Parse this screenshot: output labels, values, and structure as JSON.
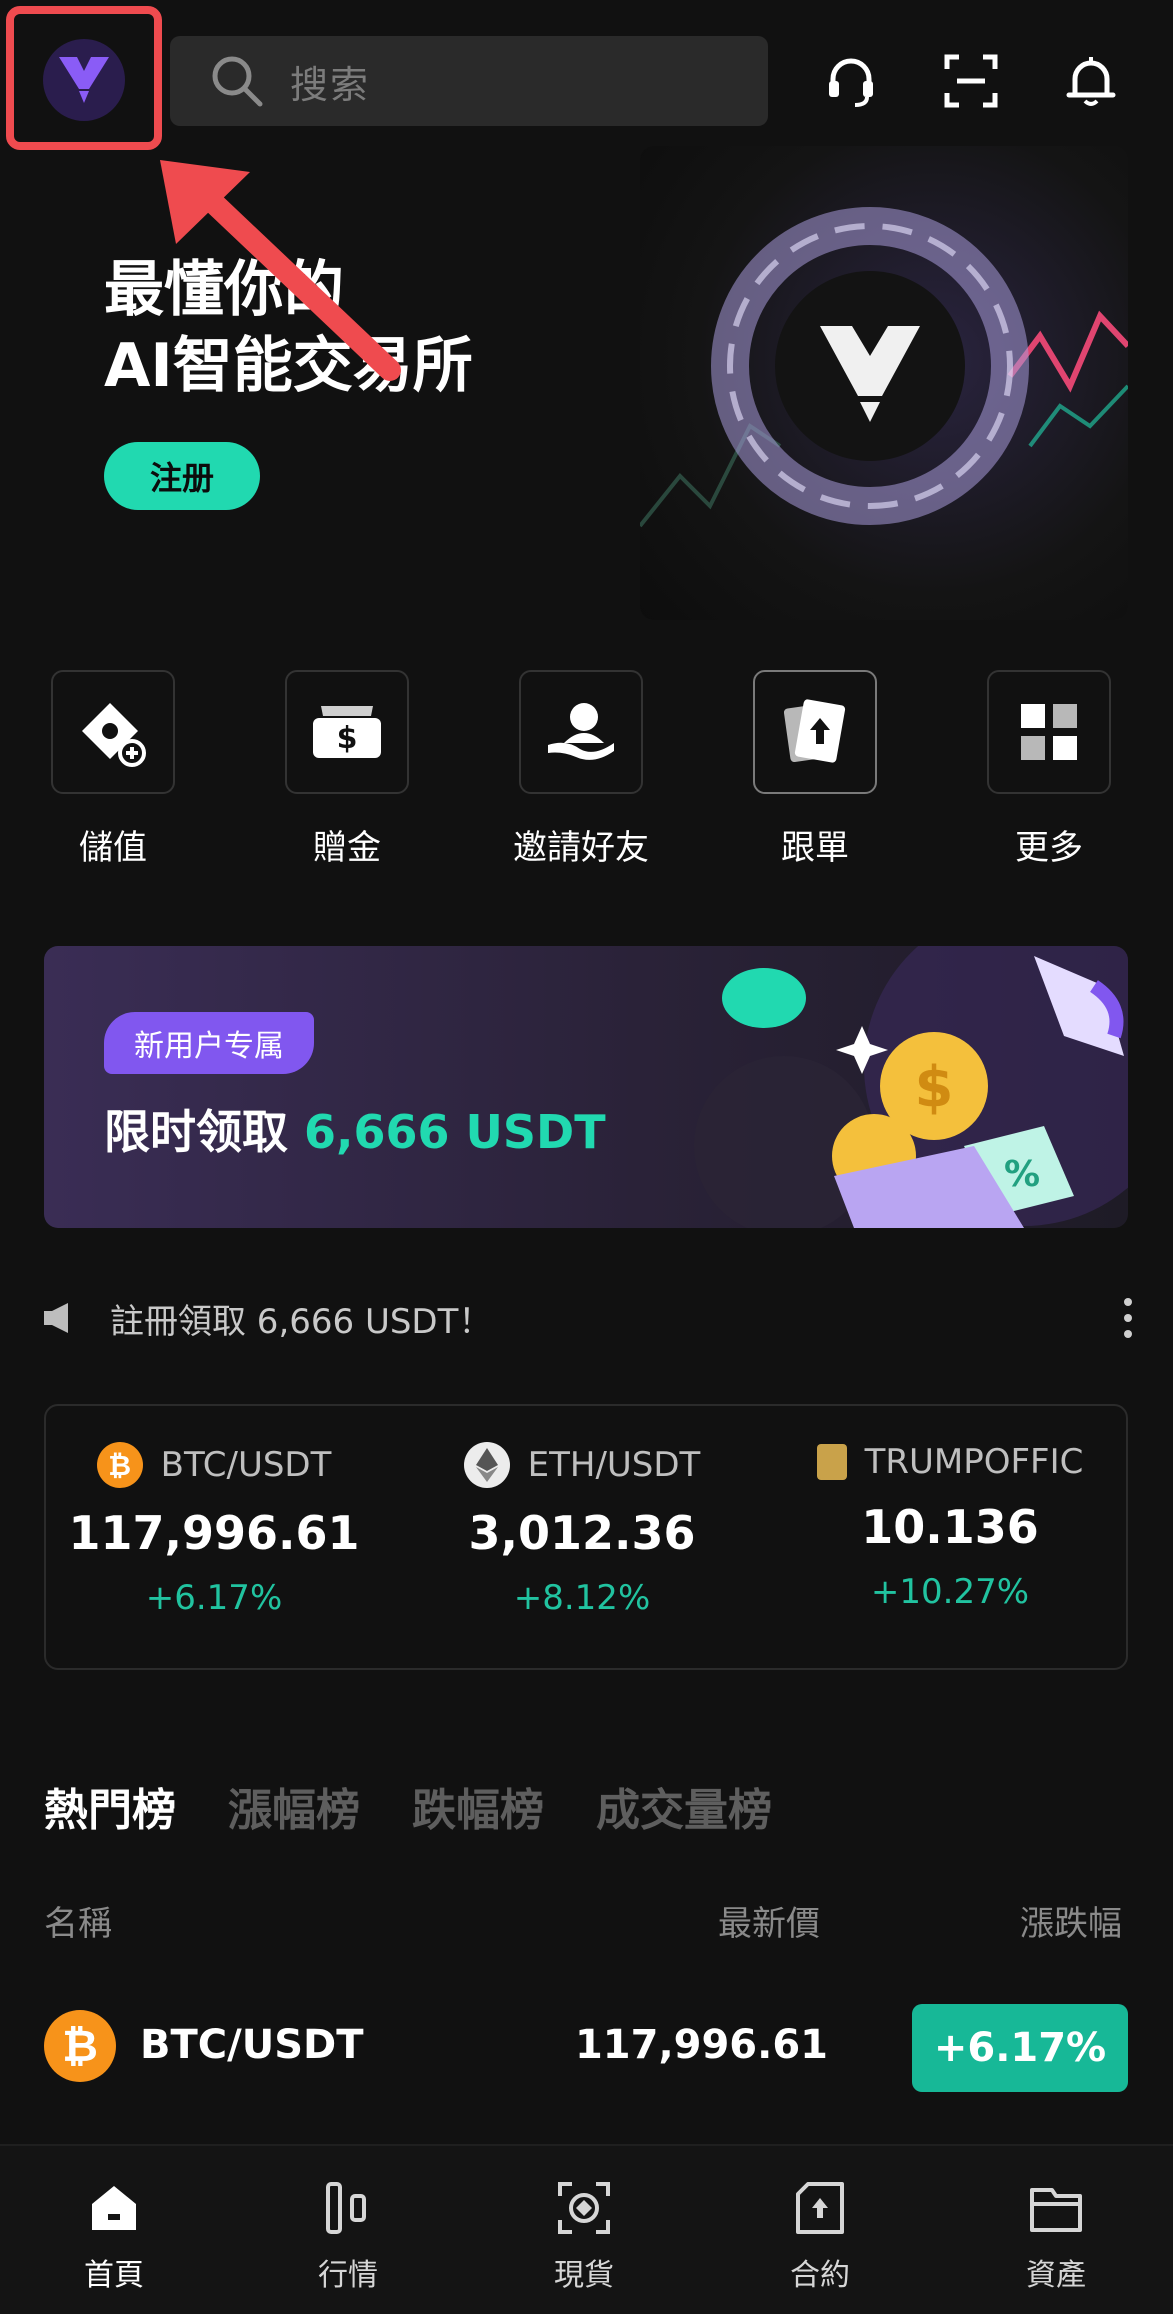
{
  "header": {
    "search_placeholder": "搜索"
  },
  "hero": {
    "title_line1": "最懂你的",
    "title_line2": "AI智能交易所",
    "register_label": "注册"
  },
  "quick_actions": [
    {
      "label": "儲值",
      "icon": "deposit-icon"
    },
    {
      "label": "贈金",
      "icon": "bonus-icon"
    },
    {
      "label": "邀請好友",
      "icon": "invite-icon"
    },
    {
      "label": "跟單",
      "icon": "copy-trade-icon"
    },
    {
      "label": "更多",
      "icon": "more-grid-icon"
    }
  ],
  "promo": {
    "badge": "新用户专属",
    "text_prefix": "限时领取 ",
    "text_highlight": "6,666 USDT"
  },
  "notice": {
    "text": "註冊領取 6,666 USDT！"
  },
  "tickers": [
    {
      "pair": "BTC/USDT",
      "price": "117,996.61",
      "change": "+6.17%"
    },
    {
      "pair": "ETH/USDT",
      "price": "3,012.36",
      "change": "+8.12%"
    },
    {
      "pair": "TRUMPOFFIC",
      "price": "10.136",
      "change": "+10.27%"
    }
  ],
  "tabs": [
    "熱門榜",
    "漲幅榜",
    "跌幅榜",
    "成交量榜"
  ],
  "columns": {
    "name": "名稱",
    "price": "最新價",
    "change": "漲跌幅"
  },
  "rows": [
    {
      "pair": "BTC/USDT",
      "price": "117,996.61",
      "change": "+6.17%"
    }
  ],
  "nav": [
    {
      "label": "首頁",
      "icon": "home-icon"
    },
    {
      "label": "行情",
      "icon": "market-icon"
    },
    {
      "label": "現貨",
      "icon": "spot-icon"
    },
    {
      "label": "合約",
      "icon": "contract-icon"
    },
    {
      "label": "資產",
      "icon": "wallet-icon"
    }
  ],
  "colors": {
    "accent": "#21d9b0",
    "up": "#17b897",
    "annotation": "#ef4b4f",
    "promo_badge": "#8157ef"
  }
}
